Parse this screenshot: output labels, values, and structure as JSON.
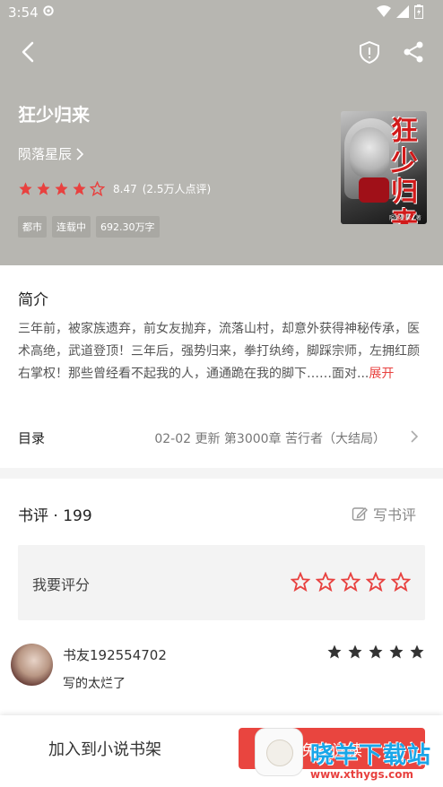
{
  "status_bar": {
    "time": "3:54",
    "icons": [
      "settings-gear-icon",
      "wifi-icon",
      "signal-icon",
      "battery-icon"
    ]
  },
  "nav": {
    "icons": [
      "back-icon",
      "shield-icon",
      "share-icon"
    ]
  },
  "book": {
    "title": "狂少归来",
    "author": "陨落星辰",
    "rating_score": "8.47",
    "rating_count": "(2.5万人点评)",
    "rating_stars": 4.5,
    "tags": [
      "都市",
      "连载中",
      "692.30万字"
    ],
    "cover": {
      "title": "狂少归来",
      "author_line": "陨落星辰 · 著"
    }
  },
  "intro": {
    "label": "简介",
    "text": "三年前，被家族遗弃，前女友抛弃，流落山村，却意外获得神秘传承，医术高绝，武道登顶！三年后，强势归来，拳打纨绔，脚踩宗师，左拥红颜右掌权！那些曾经看不起我的人，通通跪在我的脚下……面对...",
    "more": "展开"
  },
  "toc": {
    "label": "目录",
    "info": "02-02  更新  第3000章 苦行者（大结局）"
  },
  "reviews": {
    "header": "书评 · 199",
    "write_label": "写书评",
    "rate_prompt": "我要评分",
    "rate_star_count": 5,
    "comments": [
      {
        "user": "书友192554702",
        "text": "写的太烂了",
        "stars": 5
      }
    ]
  },
  "bottom_bar": {
    "add_to_shelf": "加入到小说书架",
    "read_button": "免费阅读"
  },
  "watermark": {
    "name": "晓羊下载站",
    "url": "www.xthygs.com"
  },
  "colors": {
    "header_bg": "#b7b6b1",
    "accent_red": "#e9453f",
    "star_red": "#e8413f",
    "watermark_blue": "#1aa6e8"
  }
}
